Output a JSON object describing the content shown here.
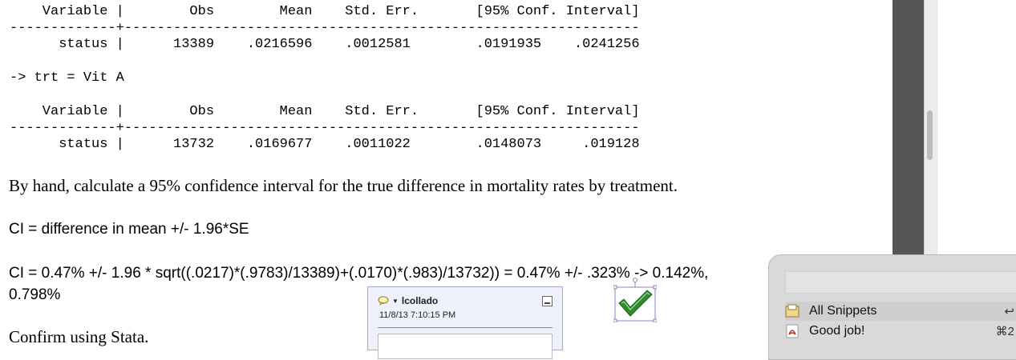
{
  "stata_output": {
    "table1": {
      "header": "    Variable |        Obs        Mean    Std. Err.       [95% Conf. Interval]",
      "separator": "-------------+---------------------------------------------------------------",
      "row": "      status |      13389    .0216596    .0012581        .0191935    .0241256"
    },
    "by_line": "-> trt = Vit A",
    "table2": {
      "header": "    Variable |        Obs        Mean    Std. Err.       [95% Conf. Interval]",
      "separator": "-------------+---------------------------------------------------------------",
      "row": "      status |      13732    .0169677    .0011022        .0148073     .019128"
    }
  },
  "document": {
    "question": "By hand, calculate a 95% confidence interval for the true difference in mortality rates by treatment.",
    "formula_line": "CI = difference in mean +/- 1.96*SE",
    "calc_line": "CI = 0.47% +/- 1.96 * sqrt((.0217)*(.9783)/13389)+(.0170)*(.983)/13732)) = 0.47% +/- .323% -> 0.142%,",
    "calc_line_cont": "0.798%",
    "confirm_line": "Confirm using Stata."
  },
  "comment": {
    "author": "lcollado",
    "timestamp": "11/8/13 7:10:15 PM"
  },
  "snippets_panel": {
    "items": [
      {
        "label": "All Snippets",
        "shortcut": "↩",
        "icon": "folder-icon"
      },
      {
        "label": "Good job!",
        "shortcut": "⌘2",
        "icon": "pdf-icon"
      }
    ]
  },
  "colors": {
    "checkmark": "#2e8b2e",
    "sidebar_dark": "#555555"
  }
}
